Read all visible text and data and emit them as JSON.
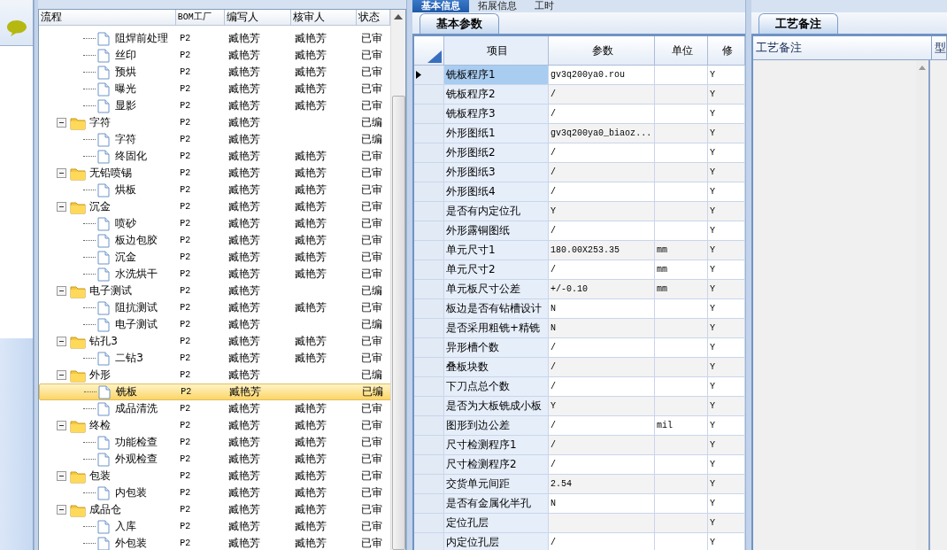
{
  "tree": {
    "columns": [
      "流程",
      "BOM工厂",
      "编写人",
      "核审人",
      "状态"
    ],
    "nodes": [
      {
        "kind": "continued",
        "children": [
          {
            "label": "阻焊前处理",
            "bom": "P2",
            "author": "臧艳芳",
            "reviewer": "臧艳芳",
            "status": "已审",
            "selected": false
          },
          {
            "label": "丝印",
            "bom": "P2",
            "author": "臧艳芳",
            "reviewer": "臧艳芳",
            "status": "已审",
            "selected": false
          },
          {
            "label": "预烘",
            "bom": "P2",
            "author": "臧艳芳",
            "reviewer": "臧艳芳",
            "status": "已审",
            "selected": false
          },
          {
            "label": "曝光",
            "bom": "P2",
            "author": "臧艳芳",
            "reviewer": "臧艳芳",
            "status": "已审",
            "selected": false
          },
          {
            "label": "显影",
            "bom": "P2",
            "author": "臧艳芳",
            "reviewer": "臧艳芳",
            "status": "已审",
            "selected": false
          }
        ]
      },
      {
        "kind": "folder",
        "label": "字符",
        "bom": "P2",
        "author": "臧艳芳",
        "status": "已编",
        "expanded": true,
        "selected": false,
        "children": [
          {
            "label": "字符",
            "bom": "P2",
            "author": "臧艳芳",
            "status": "已编",
            "selected": false
          },
          {
            "label": "终固化",
            "bom": "P2",
            "author": "臧艳芳",
            "reviewer": "臧艳芳",
            "status": "已审",
            "selected": false
          }
        ]
      },
      {
        "kind": "folder",
        "label": "无铅喷锡",
        "bom": "P2",
        "author": "臧艳芳",
        "reviewer": "臧艳芳",
        "status": "已审",
        "expanded": true,
        "selected": false,
        "children": [
          {
            "label": "烘板",
            "bom": "P2",
            "author": "臧艳芳",
            "reviewer": "臧艳芳",
            "status": "已审",
            "selected": false
          }
        ]
      },
      {
        "kind": "folder",
        "label": "沉金",
        "bom": "P2",
        "author": "臧艳芳",
        "reviewer": "臧艳芳",
        "status": "已审",
        "expanded": true,
        "selected": false,
        "children": [
          {
            "label": "喷砂",
            "bom": "P2",
            "author": "臧艳芳",
            "reviewer": "臧艳芳",
            "status": "已审",
            "selected": false
          },
          {
            "label": "板边包胶",
            "bom": "P2",
            "author": "臧艳芳",
            "reviewer": "臧艳芳",
            "status": "已审",
            "selected": false
          },
          {
            "label": "沉金",
            "bom": "P2",
            "author": "臧艳芳",
            "reviewer": "臧艳芳",
            "status": "已审",
            "selected": false
          },
          {
            "label": "水洗烘干",
            "bom": "P2",
            "author": "臧艳芳",
            "reviewer": "臧艳芳",
            "status": "已审",
            "selected": false
          }
        ]
      },
      {
        "kind": "folder",
        "label": "电子测试",
        "bom": "P2",
        "author": "臧艳芳",
        "status": "已编",
        "expanded": true,
        "selected": false,
        "children": [
          {
            "label": "阻抗测试",
            "bom": "P2",
            "author": "臧艳芳",
            "reviewer": "臧艳芳",
            "status": "已审",
            "selected": false
          },
          {
            "label": "电子测试",
            "bom": "P2",
            "author": "臧艳芳",
            "status": "已编",
            "selected": false
          }
        ]
      },
      {
        "kind": "folder",
        "label": "钻孔3",
        "bom": "P2",
        "author": "臧艳芳",
        "reviewer": "臧艳芳",
        "status": "已审",
        "expanded": true,
        "selected": false,
        "children": [
          {
            "label": "二钻3",
            "bom": "P2",
            "author": "臧艳芳",
            "reviewer": "臧艳芳",
            "status": "已审",
            "selected": false
          }
        ]
      },
      {
        "kind": "folder",
        "label": "外形",
        "bom": "P2",
        "author": "臧艳芳",
        "status": "已编",
        "expanded": true,
        "selected": false,
        "children": [
          {
            "label": "铣板",
            "bom": "P2",
            "author": "臧艳芳",
            "status": "已编",
            "selected": true
          },
          {
            "label": "成品清洗",
            "bom": "P2",
            "author": "臧艳芳",
            "reviewer": "臧艳芳",
            "status": "已审",
            "selected": false
          }
        ]
      },
      {
        "kind": "folder",
        "label": "终检",
        "bom": "P2",
        "author": "臧艳芳",
        "reviewer": "臧艳芳",
        "status": "已审",
        "expanded": true,
        "selected": false,
        "children": [
          {
            "label": "功能检查",
            "bom": "P2",
            "author": "臧艳芳",
            "reviewer": "臧艳芳",
            "status": "已审",
            "selected": false
          },
          {
            "label": "外观检查",
            "bom": "P2",
            "author": "臧艳芳",
            "reviewer": "臧艳芳",
            "status": "已审",
            "selected": false
          }
        ]
      },
      {
        "kind": "folder",
        "label": "包装",
        "bom": "P2",
        "author": "臧艳芳",
        "reviewer": "臧艳芳",
        "status": "已审",
        "expanded": true,
        "selected": false,
        "children": [
          {
            "label": "内包装",
            "bom": "P2",
            "author": "臧艳芳",
            "reviewer": "臧艳芳",
            "status": "已审",
            "selected": false
          }
        ]
      },
      {
        "kind": "folder",
        "label": "成品仓",
        "bom": "P2",
        "author": "臧艳芳",
        "reviewer": "臧艳芳",
        "status": "已审",
        "expanded": true,
        "selected": false,
        "children": [
          {
            "label": "入库",
            "bom": "P2",
            "author": "臧艳芳",
            "reviewer": "臧艳芳",
            "status": "已审",
            "selected": false
          },
          {
            "label": "外包装",
            "bom": "P2",
            "author": "臧艳芳",
            "reviewer": "臧艳芳",
            "status": "已审",
            "selected": false
          }
        ]
      }
    ]
  },
  "main_tabs": [
    {
      "label": "基本信息",
      "selected": true
    },
    {
      "label": "拓展信息",
      "selected": false
    },
    {
      "label": "工时",
      "selected": false
    }
  ],
  "sub_tab": "基本参数",
  "grid": {
    "columns": [
      "项目",
      "参数",
      "单位",
      "修"
    ],
    "rows": [
      {
        "item": "铣板程序1",
        "param": "gv3q200ya0.rou",
        "modify": "Y",
        "selected": true
      },
      {
        "item": "铣板程序2",
        "param": "/",
        "modify": "Y",
        "selected": false
      },
      {
        "item": "铣板程序3",
        "param": "/",
        "modify": "Y",
        "selected": false
      },
      {
        "item": "外形图纸1",
        "param": "gv3q200ya0_biaoz...",
        "modify": "Y",
        "selected": false
      },
      {
        "item": "外形图纸2",
        "param": "/",
        "modify": "Y",
        "selected": false
      },
      {
        "item": "外形图纸3",
        "param": "/",
        "modify": "Y",
        "selected": false
      },
      {
        "item": "外形图纸4",
        "param": "/",
        "modify": "Y",
        "selected": false
      },
      {
        "item": "是否有内定位孔",
        "param": "Y",
        "modify": "Y",
        "selected": false
      },
      {
        "item": "外形露铜图纸",
        "param": "/",
        "modify": "Y",
        "selected": false
      },
      {
        "item": "单元尺寸1",
        "param": "180.00X253.35",
        "unit": "mm",
        "modify": "Y",
        "selected": false
      },
      {
        "item": "单元尺寸2",
        "param": "/",
        "unit": "mm",
        "modify": "Y",
        "selected": false
      },
      {
        "item": "单元板尺寸公差",
        "param": "+/-0.10",
        "unit": "mm",
        "modify": "Y",
        "selected": false
      },
      {
        "item": "板边是否有钻槽设计",
        "param": "N",
        "modify": "Y",
        "selected": false
      },
      {
        "item": "是否采用粗铣+精铣",
        "param": "N",
        "modify": "Y",
        "selected": false
      },
      {
        "item": "异形槽个数",
        "param": "/",
        "modify": "Y",
        "selected": false
      },
      {
        "item": "叠板块数",
        "param": "/",
        "modify": "Y",
        "selected": false
      },
      {
        "item": "下刀点总个数",
        "param": "/",
        "modify": "Y",
        "selected": false
      },
      {
        "item": "是否为大板铣成小板",
        "param": "Y",
        "modify": "Y",
        "selected": false
      },
      {
        "item": "图形到边公差",
        "param": "/",
        "unit": "mil",
        "modify": "Y",
        "selected": false
      },
      {
        "item": "尺寸检测程序1",
        "param": "/",
        "modify": "Y",
        "selected": false
      },
      {
        "item": "尺寸检测程序2",
        "param": "/",
        "modify": "Y",
        "selected": false
      },
      {
        "item": "交货单元间距",
        "param": "2.54",
        "modify": "Y",
        "selected": false
      },
      {
        "item": "是否有金属化半孔",
        "param": "N",
        "modify": "Y",
        "selected": false
      },
      {
        "item": "定位孔层",
        "modify": "Y",
        "selected": false
      },
      {
        "item": "内定位孔层",
        "param": "/",
        "modify": "Y",
        "selected": false
      }
    ]
  },
  "notes": {
    "tab": "工艺备注",
    "columns": [
      "工艺备注",
      "型"
    ]
  }
}
